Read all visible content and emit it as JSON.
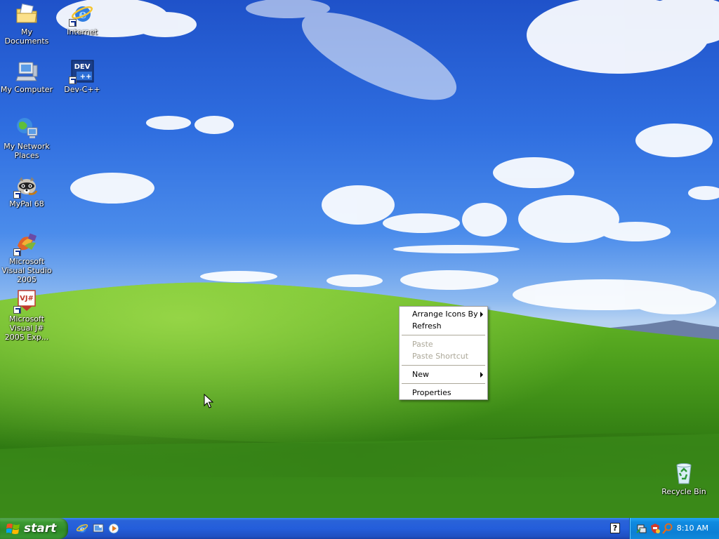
{
  "desktop": {
    "icons": [
      {
        "label": "My Documents",
        "icon": "folder-documents-icon",
        "shortcut": false
      },
      {
        "label": "Internet",
        "icon": "internet-explorer-icon",
        "shortcut": true
      },
      {
        "label": "My Computer",
        "icon": "computer-icon",
        "shortcut": false
      },
      {
        "label": "Dev-C++",
        "icon": "devcpp-icon",
        "icon_text": "DEV",
        "shortcut": true
      },
      {
        "label": "My Network Places",
        "icon": "network-places-icon",
        "shortcut": false
      },
      {
        "label": "MyPal 68",
        "icon": "mypal-raccoon-icon",
        "shortcut": true
      },
      {
        "label": "Microsoft Visual Studio 2005",
        "icon": "visual-studio-icon",
        "shortcut": true
      },
      {
        "label": "Microsoft Visual J# 2005 Exp...",
        "icon": "visual-jsharp-icon",
        "icon_text": "VJ#",
        "shortcut": true
      },
      {
        "label": "Recycle Bin",
        "icon": "recycle-bin-icon",
        "shortcut": false
      }
    ]
  },
  "context_menu": {
    "items": [
      {
        "label": "Arrange Icons By",
        "submenu": true,
        "enabled": true
      },
      {
        "label": "Refresh",
        "submenu": false,
        "enabled": true
      },
      {
        "label": "Paste",
        "submenu": false,
        "enabled": false
      },
      {
        "label": "Paste Shortcut",
        "submenu": false,
        "enabled": false
      },
      {
        "label": "New",
        "submenu": true,
        "enabled": true
      },
      {
        "label": "Properties",
        "submenu": false,
        "enabled": true
      }
    ]
  },
  "taskbar": {
    "start_label": "start",
    "quick_launch": [
      "internet-explorer-icon",
      "show-desktop-icon",
      "media-player-icon"
    ],
    "help_icon_text": "?",
    "tray_icons": [
      "network-icon",
      "security-icon",
      "search-icon"
    ],
    "clock": "8:10 AM"
  },
  "colors": {
    "taskbar_blue": "#245edb",
    "start_green": "#3c9a32",
    "tray_blue": "#0c7fd5",
    "disabled_text": "#aca899"
  }
}
